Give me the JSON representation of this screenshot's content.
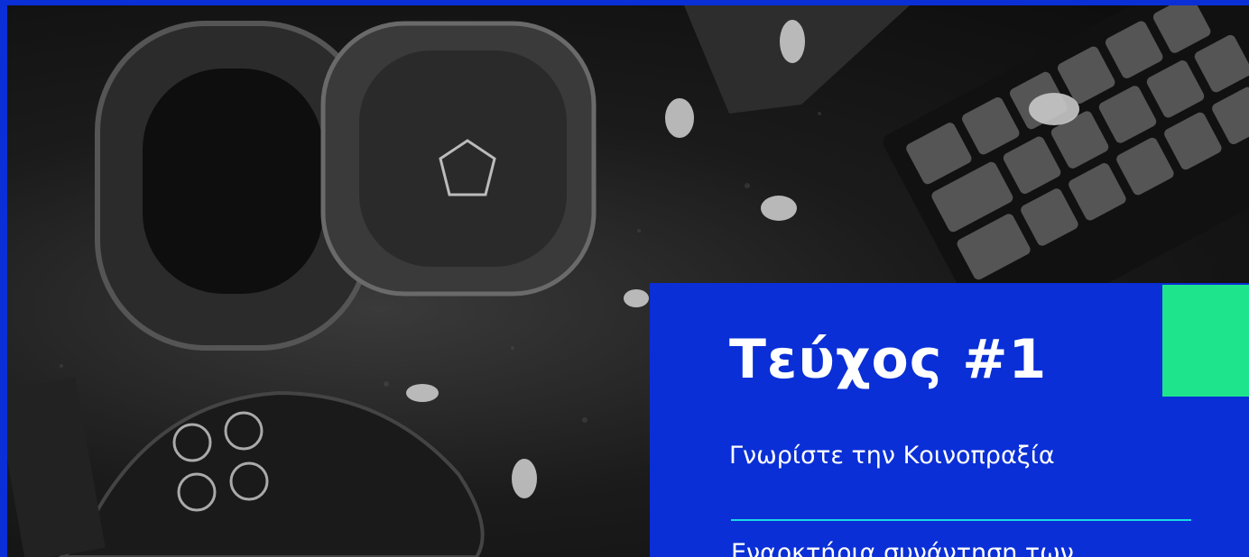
{
  "hero": {
    "image_description_icon": "headphones-keyboard-gamepad-photo"
  },
  "panel": {
    "title": "Τεύχος #1",
    "subtitle": "Γνωρίστε την Κοινοπραξία",
    "next_item": "Εναρκτήρια συνάντηση των"
  },
  "colors": {
    "brand_blue": "#0a2fd6",
    "accent_green": "#1ee58c",
    "divider_cyan": "#1ad9e6"
  }
}
